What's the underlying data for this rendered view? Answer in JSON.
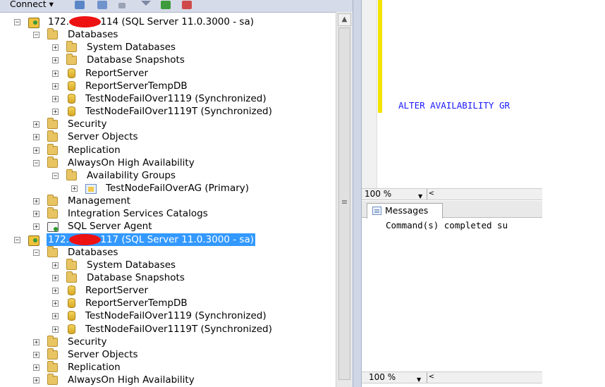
{
  "toolbar": {
    "connect_label": "Connect ▾",
    "icons": [
      "connect-object-explorer-icon",
      "disconnect-icon",
      "stop-icon",
      "filter-icon",
      "refresh-icon",
      "remove-icon"
    ]
  },
  "servers": [
    {
      "label_prefix": "172.",
      "label_suffix": ".114 (SQL Server 11.0.3000 - sa)",
      "selected": false,
      "databases_label": "Databases",
      "db_children": [
        {
          "label": "System Databases",
          "icon": "folder-icon"
        },
        {
          "label": "Database Snapshots",
          "icon": "folder-icon"
        },
        {
          "label": "ReportServer",
          "icon": "database-icon"
        },
        {
          "label": "ReportServerTempDB",
          "icon": "database-icon"
        },
        {
          "label": "TestNodeFailOver1119 (Synchronized)",
          "icon": "database-icon"
        },
        {
          "label": "TestNodeFailOver1119T (Synchronized)",
          "icon": "database-icon"
        }
      ],
      "nodes": {
        "security": "Security",
        "server_objects": "Server Objects",
        "replication": "Replication",
        "alwayson": "AlwaysOn High Availability",
        "availability_groups": "Availability Groups",
        "ag_item": "TestNodeFailOverAG (Primary)",
        "management": "Management",
        "integration": "Integration Services Catalogs",
        "agent": "SQL Server Agent"
      }
    },
    {
      "label_prefix": "172.",
      "label_suffix": ".117 (SQL Server 11.0.3000 - sa)",
      "selected": true,
      "databases_label": "Databases",
      "db_children": [
        {
          "label": "System Databases",
          "icon": "folder-icon"
        },
        {
          "label": "Database Snapshots",
          "icon": "folder-icon"
        },
        {
          "label": "ReportServer",
          "icon": "database-icon"
        },
        {
          "label": "ReportServerTempDB",
          "icon": "database-icon"
        },
        {
          "label": "TestNodeFailOver1119 (Synchronized)",
          "icon": "database-icon"
        },
        {
          "label": "TestNodeFailOver1119T (Synchronized)",
          "icon": "database-icon"
        }
      ],
      "nodes": {
        "security": "Security",
        "server_objects": "Server Objects",
        "replication": "Replication",
        "alwayson": "AlwaysOn High Availability"
      }
    }
  ],
  "editor": {
    "code_line": "ALTER AVAILABILITY GR",
    "zoom": "100 %"
  },
  "results": {
    "tab_label": "Messages",
    "message": "Command(s) completed su",
    "zoom": "100 %"
  },
  "colors": {
    "selection": "#3399ff",
    "keyword_blue": "#1a1aff",
    "change_marker": "#f3e300",
    "redaction": "#ee1111"
  }
}
